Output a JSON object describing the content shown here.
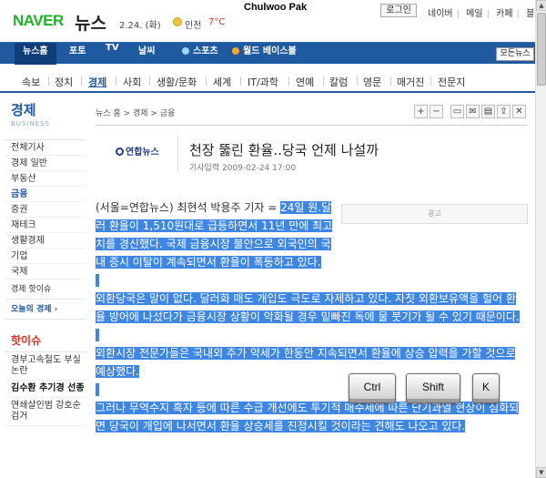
{
  "header": {
    "logo": "NAVER",
    "section": "뉴스",
    "date": "2.24. (화)",
    "city": "인천",
    "temp": "7°C",
    "username": "Chulwoo Pak",
    "login_label": "로그인",
    "links": [
      "네이버",
      "메일",
      "카페",
      "블"
    ]
  },
  "section_nav": {
    "items": [
      "뉴스홈",
      "포토",
      "TV",
      "날씨",
      "스포츠",
      "월드 베이스볼"
    ],
    "all_news_label": "모든뉴스"
  },
  "categories": [
    "속보",
    "정치",
    "경제",
    "사회",
    "생활/문화",
    "세계",
    "IT/과학",
    "연예",
    "칼럼",
    "영문",
    "매거진",
    "전문지"
  ],
  "sidebar": {
    "title": "경제",
    "subtitle": "BUSINESS",
    "items": [
      "전체기사",
      "경제 일반",
      "부동산",
      "금융",
      "증권",
      "재테크",
      "생활경제",
      "기업",
      "국제"
    ],
    "link_label": "경제 핫이슈",
    "today_label": "오늘의 경제 ›",
    "hot_title": "핫이슈",
    "hot_items": [
      "경부고속철도 부실 논란",
      "김수환 추기경 선종",
      "연쇄살인범 강호순 검거"
    ]
  },
  "article": {
    "breadcrumb": "뉴스 홈 > 경제 > 금융",
    "toolbar": [
      "+",
      "−",
      "print",
      "mail",
      "save",
      "share",
      "close"
    ],
    "source": "연합뉴스",
    "headline": "천장 뚫린 환율..당국 언제 나설까",
    "pubdate": "기사입력 2009-02-24 17:00",
    "ad_label": "광고",
    "lead_unselected": "(서울=연합뉴스) 최현석 박용주 기자 = ",
    "lead_selected": "24일 원.달러 환율이 1,510원대로 급등하면서 11년 만에 최고치를 경신했다. 국제 금융시장 불안으로 외국인의 국내 증시 이탈이 계속되면서 환율이 폭등하고 있다.",
    "para2": "외환당국은 말이 없다. 달러화 매도 개입도 극도로 자제하고 있다. 자칫 외환보유액을 헐어 환율 방어에 나섰다가 금융시장 상황이 악화될 경우 밑빠진 독에 물 붓기가 될 수 있기 때문이다.",
    "para3": "외환시장 전문가들은 국내외 주가 약세가 한동안 지속되면서 환율에 상승 압력을 가할 것으로 예상했다.",
    "para4": "그러나 무역수지 흑자 등에 따른 수급 개선에도 투기적 매수세에 따른 단기과열 현상이 심화되면 당국이 개입에 나서면서 환율 상승세를 진정시킬 것이라는 견해도 나오고 있다."
  },
  "keys": [
    "Ctrl",
    "Shift",
    "K"
  ]
}
